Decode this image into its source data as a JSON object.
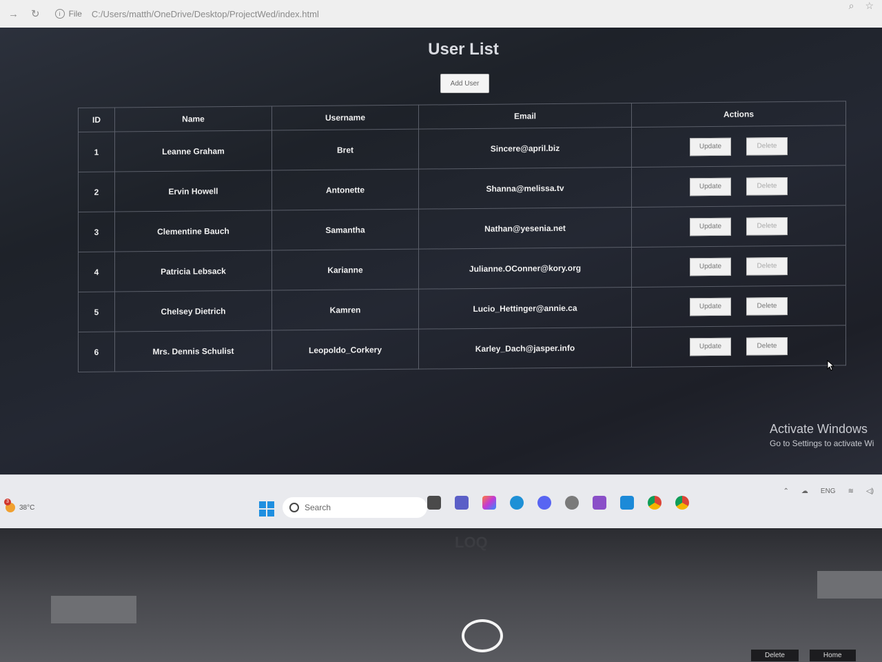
{
  "browser": {
    "scheme_label": "File",
    "url": "C:/Users/matth/OneDrive/Desktop/ProjectWed/index.html"
  },
  "page": {
    "title": "User List",
    "add_button": "Add User",
    "table": {
      "headers": {
        "id": "ID",
        "name": "Name",
        "username": "Username",
        "email": "Email",
        "actions": "Actions"
      },
      "rows": [
        {
          "id": "1",
          "name": "Leanne Graham",
          "username": "Bret",
          "email": "Sincere@april.biz",
          "update": "Update",
          "delete": "Delete"
        },
        {
          "id": "2",
          "name": "Ervin Howell",
          "username": "Antonette",
          "email": "Shanna@melissa.tv",
          "update": "Update",
          "delete": "Delete"
        },
        {
          "id": "3",
          "name": "Clementine Bauch",
          "username": "Samantha",
          "email": "Nathan@yesenia.net",
          "update": "Update",
          "delete": "Delete"
        },
        {
          "id": "4",
          "name": "Patricia Lebsack",
          "username": "Karianne",
          "email": "Julianne.OConner@kory.org",
          "update": "Update",
          "delete": "Delete"
        },
        {
          "id": "5",
          "name": "Chelsey Dietrich",
          "username": "Kamren",
          "email": "Lucio_Hettinger@annie.ca",
          "update": "Update",
          "delete": "Delete"
        },
        {
          "id": "6",
          "name": "Mrs. Dennis Schulist",
          "username": "Leopoldo_Corkery",
          "email": "Karley_Dach@jasper.info",
          "update": "Update",
          "delete": "Delete"
        }
      ]
    }
  },
  "watermark": {
    "line1": "Activate Windows",
    "line2": "Go to Settings to activate Wi"
  },
  "taskbar": {
    "temperature": "38°C",
    "weather_badge": "3",
    "search_placeholder": "Search",
    "language": "ENG"
  },
  "laptop": {
    "key1": "Delete",
    "key2": "Home"
  }
}
